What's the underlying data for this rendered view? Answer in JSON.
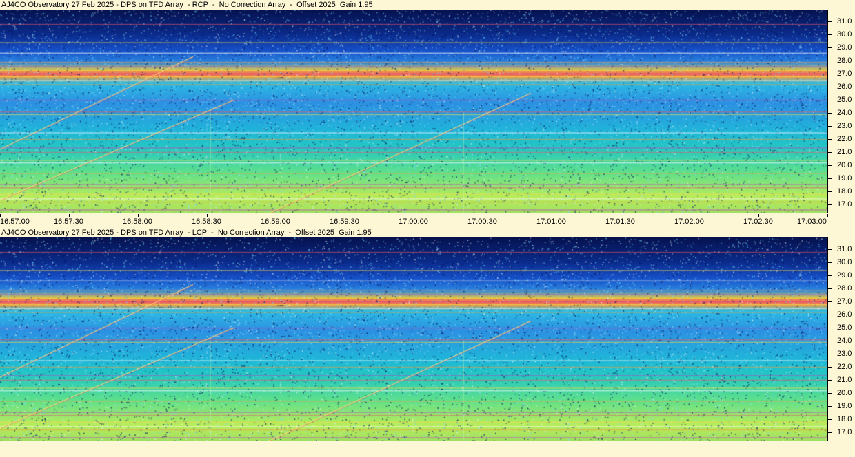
{
  "chart_data": [
    {
      "type": "heatmap",
      "title": "AJ4CO Observatory 27 Feb 2025 - DPS on TFD Array  - RCP  -  No Correction Array  -  Offset 2025  Gain 1.95",
      "x_ticks": [
        "16:57:00",
        "16:57:30",
        "16:58:00",
        "16:58:30",
        "16:59:00",
        "16:59:30",
        "17:00:00",
        "17:00:30",
        "17:01:00",
        "17:01:30",
        "17:02:00",
        "17:02:30",
        "17:03:00"
      ],
      "x_range": [
        "16:57:00",
        "17:03:00"
      ],
      "y_ticks": [
        "17.0",
        "18.0",
        "19.0",
        "20.0",
        "21.0",
        "22.0",
        "23.0",
        "24.0",
        "25.0",
        "26.0",
        "27.0",
        "28.0",
        "29.0",
        "30.0",
        "31.0"
      ],
      "y_range": [
        16.3,
        31.9
      ],
      "color_scale": [
        "#06124e",
        "#1650c8",
        "#2bbbe2",
        "#5ee08a",
        "#f0c83a",
        "#e8556a"
      ]
    },
    {
      "type": "heatmap",
      "title": "AJ4CO Observatory 27 Feb 2025 - DPS on TFD Array  - LCP  -  No Correction Array  -  Offset 2025  Gain 1.95",
      "x_ticks": [],
      "x_range": [
        "16:57:00",
        "17:03:00"
      ],
      "y_ticks": [
        "17.0",
        "18.0",
        "19.0",
        "20.0",
        "21.0",
        "22.0",
        "23.0",
        "24.0",
        "25.0",
        "26.0",
        "27.0",
        "28.0",
        "29.0",
        "30.0",
        "31.0"
      ],
      "y_range": [
        16.3,
        31.9
      ],
      "color_scale": [
        "#06124e",
        "#1650c8",
        "#2bbbe2",
        "#5ee08a",
        "#f0c83a",
        "#e8556a"
      ]
    }
  ]
}
